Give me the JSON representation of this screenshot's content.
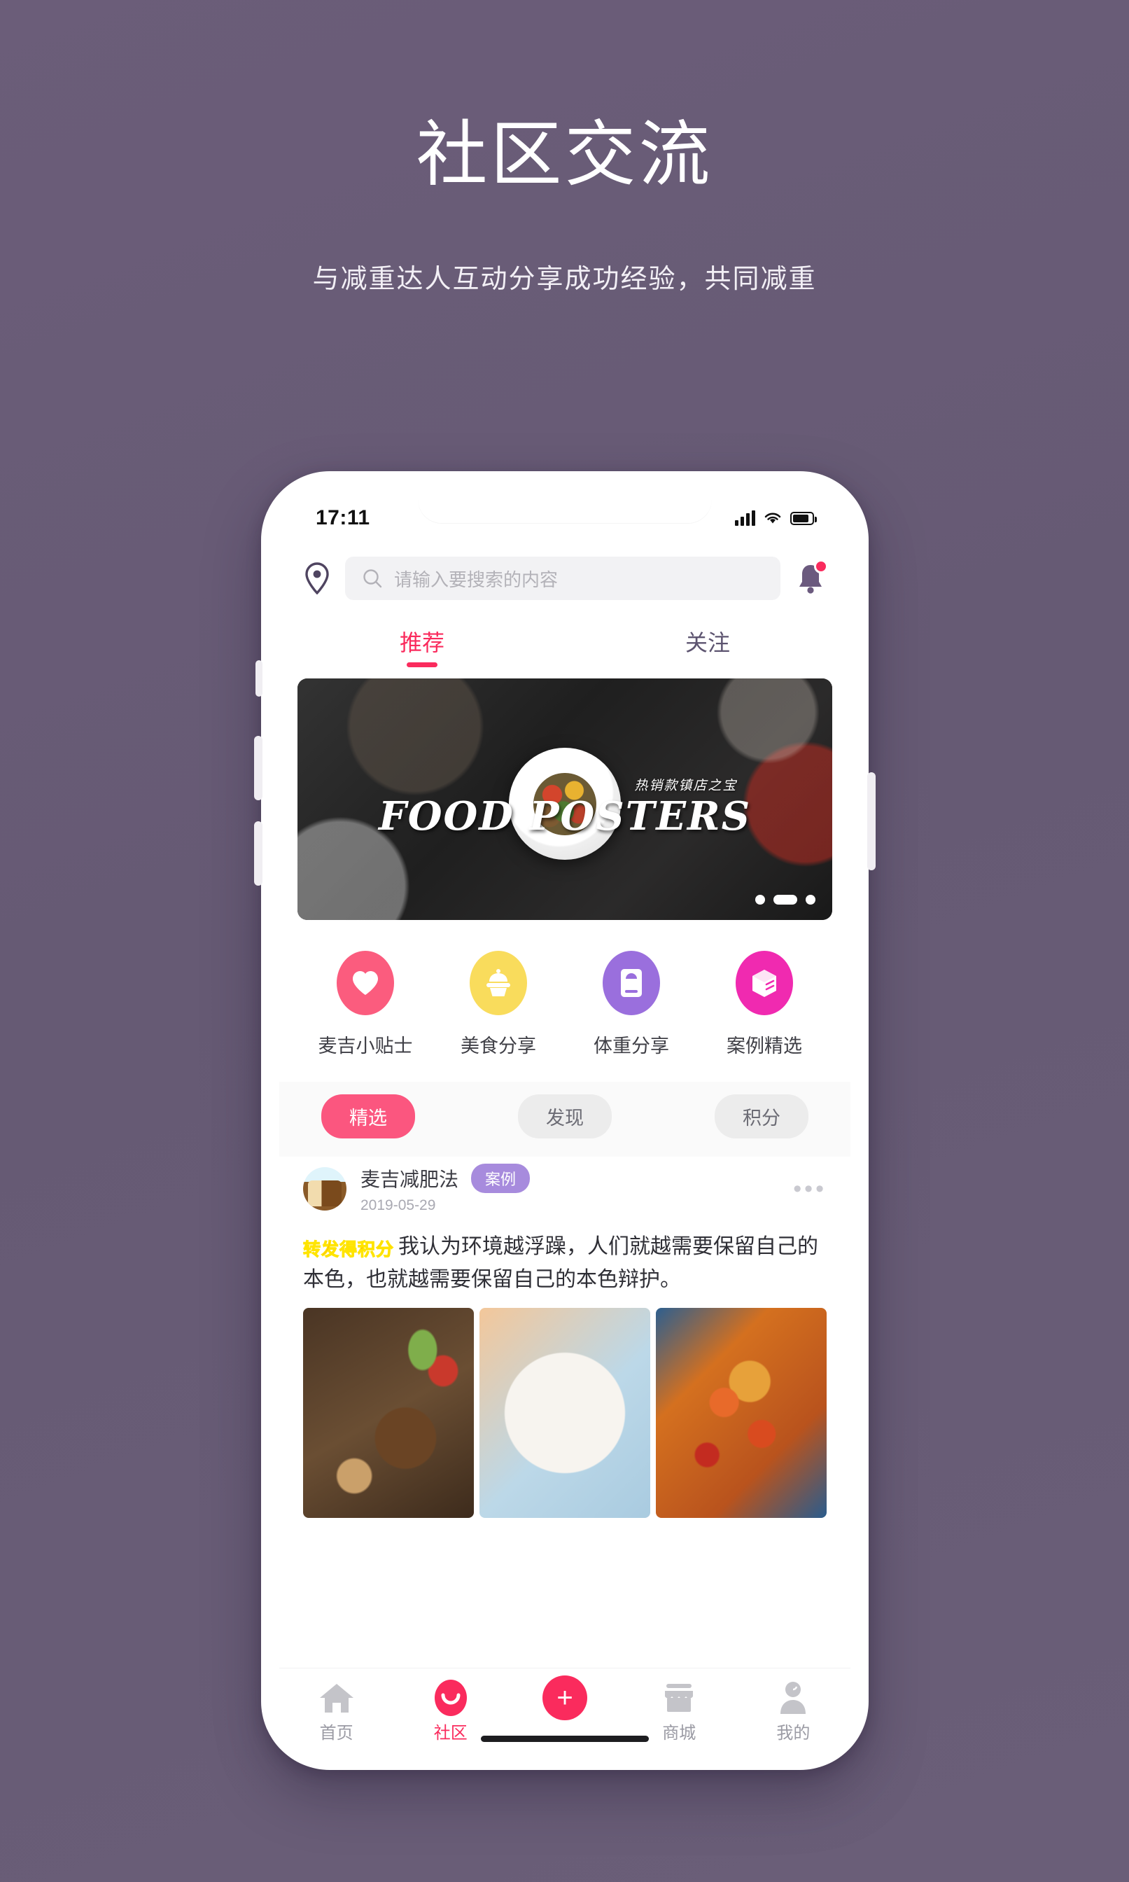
{
  "hero": {
    "title": "社区交流",
    "subtitle": "与减重达人互动分享成功经验，共同减重"
  },
  "status_bar": {
    "time": "17:11",
    "signal_icon": "signal-bars-icon",
    "wifi_icon": "wifi-icon",
    "battery_icon": "battery-icon"
  },
  "search": {
    "location_icon": "location-pin-icon",
    "search_icon": "search-icon",
    "placeholder": "请输入要搜索的内容",
    "value": "",
    "bell_icon": "bell-icon",
    "has_notification": true
  },
  "tabs": [
    {
      "label": "推荐",
      "active": true
    },
    {
      "label": "关注",
      "active": false
    }
  ],
  "banner": {
    "title": "FOOD POSTERS",
    "caption": "热销款镇店之宝",
    "dots": 3,
    "active_dot": 2
  },
  "categories": [
    {
      "label": "麦吉小贴士",
      "icon": "heart-icon",
      "color": "#fb5c7e"
    },
    {
      "label": "美食分享",
      "icon": "cupcake-icon",
      "color": "#f9dc5c"
    },
    {
      "label": "体重分享",
      "icon": "scale-icon",
      "color": "#9a6fdd"
    },
    {
      "label": "案例精选",
      "icon": "box-icon",
      "color": "#f02ab0"
    }
  ],
  "chips": [
    {
      "label": "精选",
      "active": true
    },
    {
      "label": "发现",
      "active": false
    },
    {
      "label": "积分",
      "active": false
    }
  ],
  "post": {
    "author": "麦吉减肥法",
    "tag": "案例",
    "date": "2019-05-29",
    "more_icon": "more-dots-icon",
    "badge_part1": "转发",
    "badge_part2": "得积分",
    "text": "我认为环境越浮躁，人们就越需要保留自己的本色，也就越需要保留自己的本色辩护。",
    "images": [
      {
        "name": "grilled-steak-vegetables-photo"
      },
      {
        "name": "noodle-soup-bowl-photo"
      },
      {
        "name": "seafood-rice-pot-photo"
      }
    ]
  },
  "tabbar": [
    {
      "label": "首页",
      "icon": "home-icon",
      "active": false
    },
    {
      "label": "社区",
      "icon": "community-smile-icon",
      "active": true
    },
    {
      "label": "",
      "icon": "plus-icon",
      "active": false
    },
    {
      "label": "商城",
      "icon": "store-icon",
      "active": false
    },
    {
      "label": "我的",
      "icon": "person-icon",
      "active": false
    }
  ],
  "colors": {
    "background": "#685c76",
    "accent": "#fa2b5d",
    "chip_active": "#fb567f",
    "tag_purple": "#a78bdd"
  }
}
